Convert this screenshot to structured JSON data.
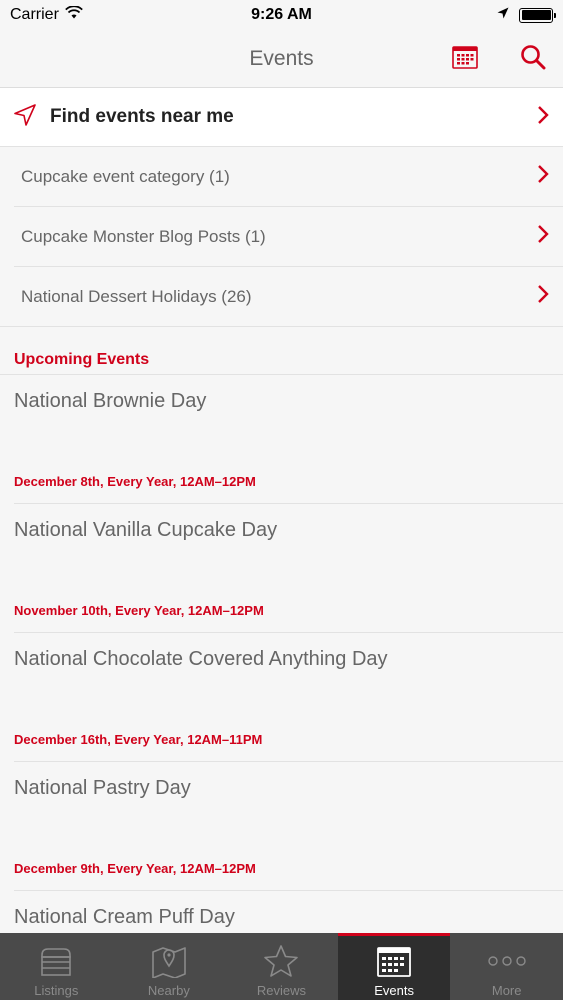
{
  "status": {
    "carrier": "Carrier",
    "time": "9:26 AM"
  },
  "nav": {
    "title": "Events"
  },
  "find_nearby": {
    "label": "Find events near me"
  },
  "categories": [
    {
      "label": "Cupcake event category (1)"
    },
    {
      "label": "Cupcake Monster Blog Posts (1)"
    },
    {
      "label": "National Dessert Holidays (26)"
    }
  ],
  "upcoming": {
    "header": "Upcoming Events",
    "events": [
      {
        "name": "National Brownie Day",
        "when": "December 8th, Every Year, 12AM–12PM"
      },
      {
        "name": "National Vanilla Cupcake Day",
        "when": "November 10th, Every Year, 12AM–12PM"
      },
      {
        "name": "National Chocolate Covered Anything Day",
        "when": "December 16th, Every Year, 12AM–11PM"
      },
      {
        "name": "National Pastry Day",
        "when": "December 9th, Every Year, 12AM–12PM"
      },
      {
        "name": "National Cream Puff Day",
        "when": ""
      }
    ]
  },
  "tabs": [
    {
      "label": "Listings",
      "icon": "listings-icon"
    },
    {
      "label": "Nearby",
      "icon": "map-icon"
    },
    {
      "label": "Reviews",
      "icon": "star-icon"
    },
    {
      "label": "Events",
      "icon": "calendar-icon",
      "active": true
    },
    {
      "label": "More",
      "icon": "more-icon"
    }
  ],
  "colors": {
    "accent": "#d0021b",
    "tabbar": "#4a4a4a",
    "tabbar_active": "#2e2e2e"
  }
}
